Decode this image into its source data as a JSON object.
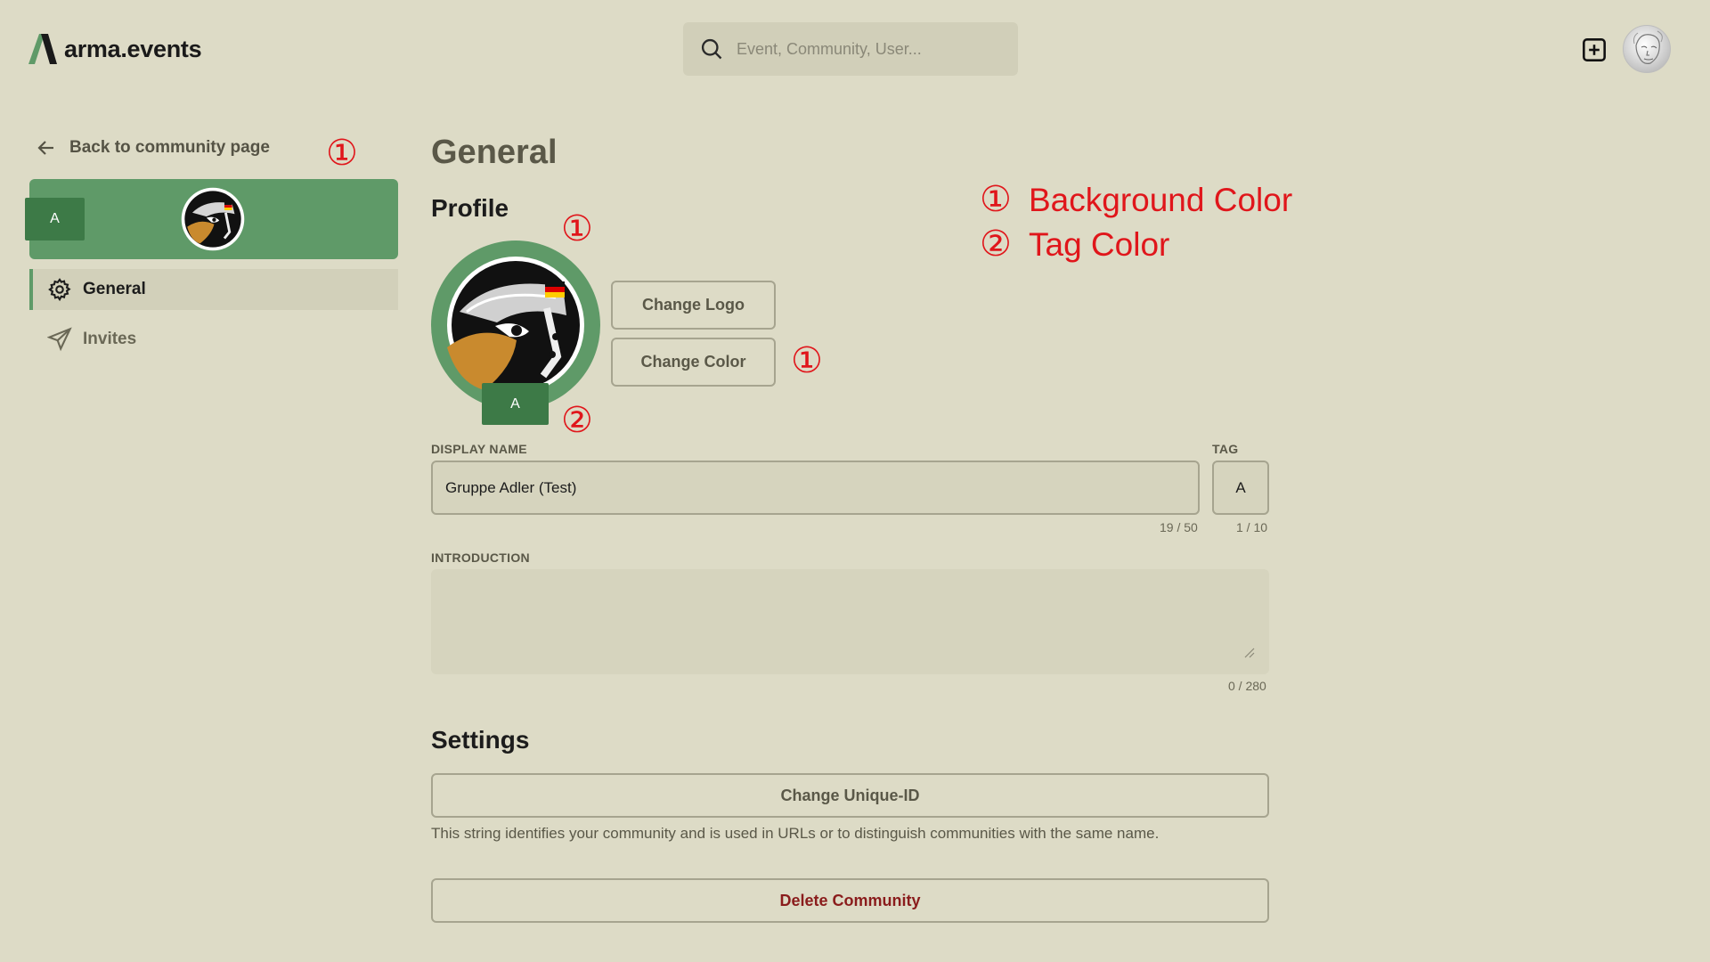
{
  "app": {
    "brand": "arma.events"
  },
  "search": {
    "placeholder": "Event, Community, User..."
  },
  "header": {
    "add_icon": "plus-square-icon",
    "avatar_icon": "user-avatar"
  },
  "sidebar": {
    "back_label": "Back to community page",
    "banner": {
      "tag": "A",
      "background_color": "#5f9a68",
      "tag_color": "#3d7a47"
    },
    "items": [
      {
        "label": "General",
        "icon": "gear-icon",
        "active": true
      },
      {
        "label": "Invites",
        "icon": "send-icon",
        "active": false
      }
    ]
  },
  "main": {
    "title": "General",
    "profile": {
      "heading": "Profile",
      "tag": "A",
      "change_logo_label": "Change Logo",
      "change_color_label": "Change Color"
    },
    "display_name": {
      "label": "DISPLAY NAME",
      "value": "Gruppe Adler (Test)",
      "counter": "19 / 50"
    },
    "tag": {
      "label": "TAG",
      "value": "A",
      "counter": "1 / 10"
    },
    "introduction": {
      "label": "INTRODUCTION",
      "value": "",
      "counter": "0 / 280"
    },
    "settings": {
      "heading": "Settings",
      "change_uid_label": "Change Unique-ID",
      "help_text": "This string identifies your community and is used in URLs or to distinguish communities with the same name.",
      "delete_label": "Delete Community"
    }
  },
  "annotations": {
    "marks": [
      "①",
      "①",
      "①",
      "②"
    ],
    "legend": [
      {
        "mark": "①",
        "text": "Background Color"
      },
      {
        "mark": "②",
        "text": "Tag Color"
      }
    ],
    "color": "#e0161b"
  }
}
